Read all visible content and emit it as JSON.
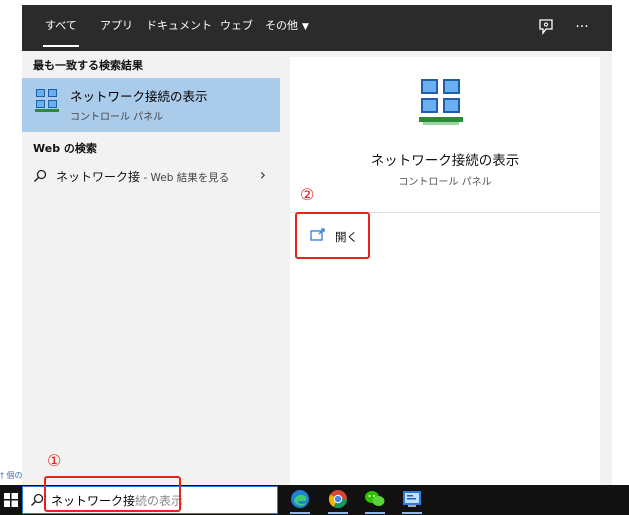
{
  "tabs": [
    {
      "label": "すべて",
      "active": true
    },
    {
      "label": "アプリ",
      "active": false
    },
    {
      "label": "ドキュメント",
      "active": false
    },
    {
      "label": "ウェブ",
      "active": false
    },
    {
      "label": "その他",
      "active": false
    }
  ],
  "header_icons": [
    "feedback-icon",
    "more-icon"
  ],
  "more_glyph": "···",
  "best_match": {
    "section_title": "最も一致する検索結果",
    "title": "ネットワーク接続の表示",
    "subtitle": "コントロール パネル"
  },
  "web_search": {
    "section_title": "Web の検索",
    "query": "ネットワーク接",
    "suffix": " - Web 結果を見る"
  },
  "detail": {
    "title": "ネットワーク接続の表示",
    "subtitle": "コントロール パネル",
    "open_label": "開く"
  },
  "annotations": {
    "marker_1": "①",
    "marker_2": "②",
    "color": "#e8221f"
  },
  "taskbar": {
    "search_typed": "ネットワーク接",
    "search_autocomplete": "続の表示",
    "apps": [
      "edge-icon",
      "chrome-icon",
      "wechat-icon",
      "control-panel-icon"
    ]
  },
  "edge_fragment": "† 個の",
  "colors": {
    "header_bg": "#2b2b2b",
    "selected_bg": "#aacbea",
    "panel_bg": "#f2f2f2",
    "taskbar_bg": "#111111",
    "accent": "#2d7de0"
  }
}
